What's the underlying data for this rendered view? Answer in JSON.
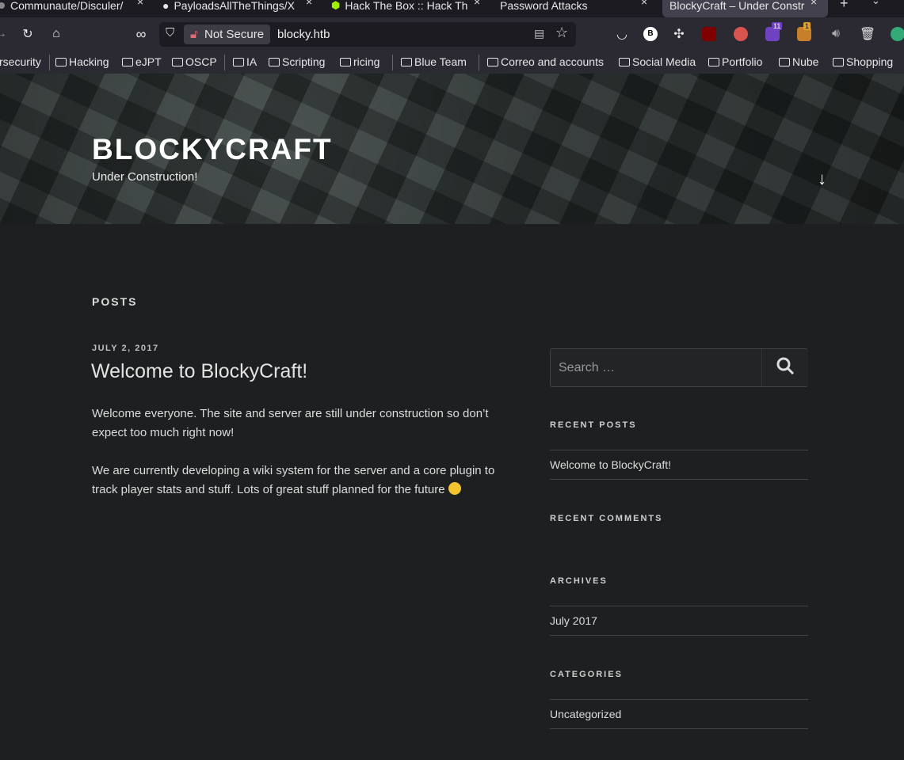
{
  "browser": {
    "tabs": [
      {
        "title": "Communaute/Disculer/",
        "active": false
      },
      {
        "title": "PayloadsAllTheThings/X",
        "active": false
      },
      {
        "title": "Hack The Box :: Hack Th",
        "active": false
      },
      {
        "title": "Password Attacks",
        "active": false
      },
      {
        "title": "BlockyCraft – Under Constr",
        "active": true
      }
    ],
    "close_glyph": "×",
    "new_tab": "+",
    "tab_list": "⌄",
    "security_label": "Not Secure",
    "url": "blocky.htb",
    "ext_badges": {
      "violet": "11",
      "orange": "1"
    },
    "bookmarks": [
      "rsecurity",
      "Hacking",
      "eJPT",
      "OSCP",
      "IA",
      "Scripting",
      "ricing",
      "Blue Team",
      "Correo and accounts",
      "Social Media",
      "Portfolio",
      "Nube",
      "Shopping"
    ]
  },
  "site": {
    "title": "BLOCKYCRAFT",
    "description": "Under Construction!",
    "scroll_arrow": "↓"
  },
  "main": {
    "heading": "POSTS",
    "post": {
      "date": "JULY 2, 2017",
      "title": "Welcome to BlockyCraft!",
      "p1": "Welcome everyone. The site and server are still under construction so don’t expect too much right now!",
      "p2": "We are currently developing a wiki system for the server and a core plugin to track player stats and stuff. Lots of great stuff planned for the future"
    }
  },
  "sidebar": {
    "search_placeholder": "Search …",
    "recent_posts_title": "RECENT POSTS",
    "recent_posts": [
      "Welcome to BlockyCraft!"
    ],
    "recent_comments_title": "RECENT COMMENTS",
    "archives_title": "ARCHIVES",
    "archives": [
      "July 2017"
    ],
    "categories_title": "CATEGORIES",
    "categories": [
      "Uncategorized"
    ]
  }
}
